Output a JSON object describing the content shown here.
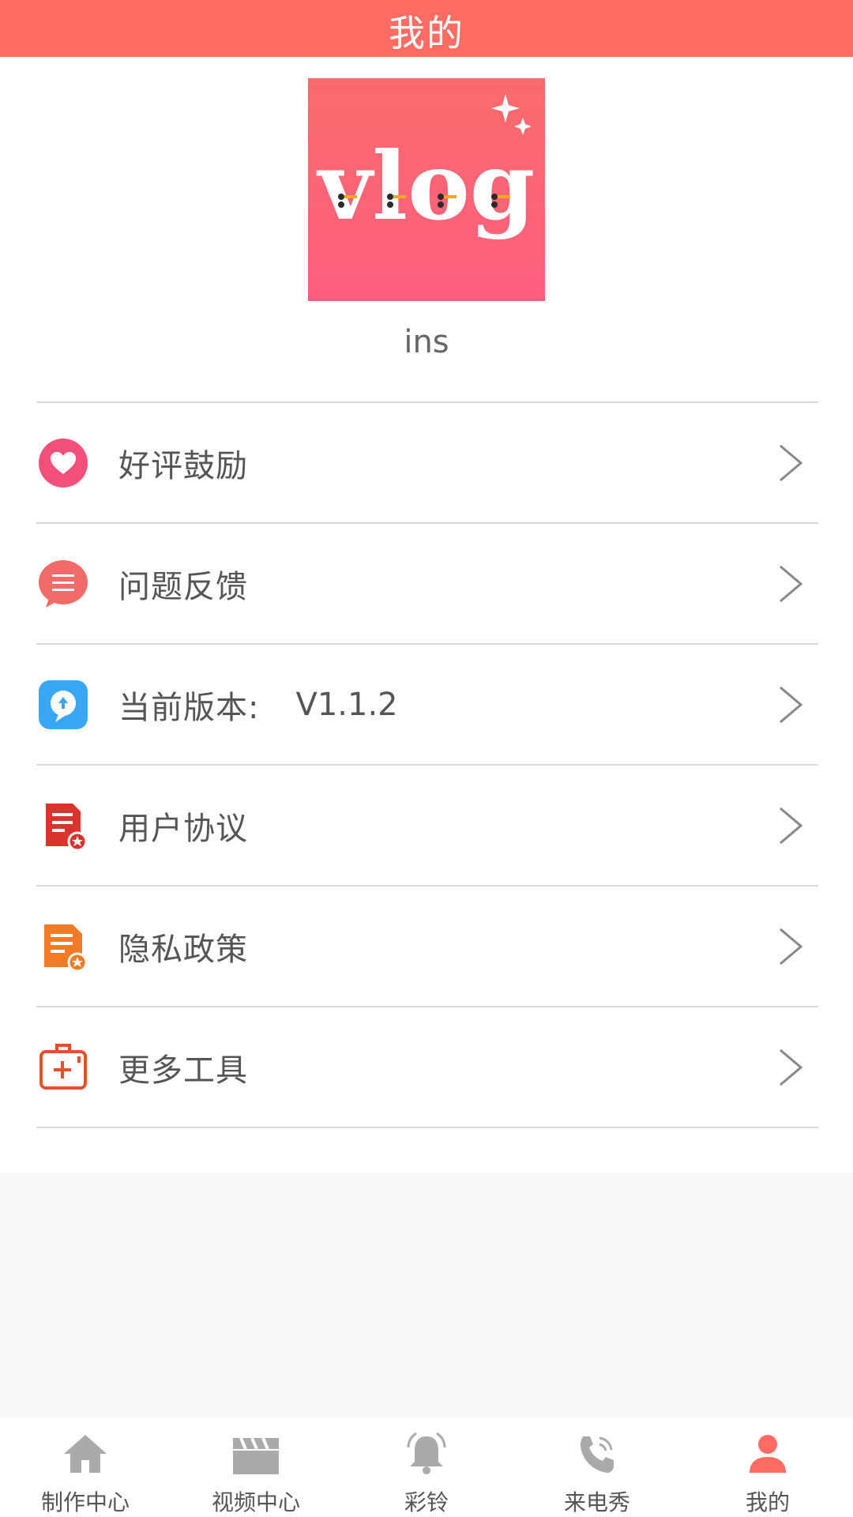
{
  "header": {
    "title": "我的"
  },
  "profile": {
    "logo_text": "vlog",
    "username": "ins"
  },
  "menu": [
    {
      "label": "好评鼓励",
      "value": "",
      "icon": "heart-icon",
      "color": "#F2507B"
    },
    {
      "label": "问题反馈",
      "value": "",
      "icon": "feedback-icon",
      "color": "#F26B6B"
    },
    {
      "label": "当前版本:",
      "value": "V1.1.2",
      "icon": "update-icon",
      "color": "#39A7F5"
    },
    {
      "label": "用户协议",
      "value": "",
      "icon": "agreement-icon",
      "color": "#D9342B"
    },
    {
      "label": "隐私政策",
      "value": "",
      "icon": "privacy-icon",
      "color": "#F07A25"
    },
    {
      "label": "更多工具",
      "value": "",
      "icon": "toolbox-icon",
      "color": "#E0532A"
    }
  ],
  "tabbar": [
    {
      "label": "制作中心",
      "icon": "home-icon",
      "active": false
    },
    {
      "label": "视频中心",
      "icon": "clapperboard-icon",
      "active": false
    },
    {
      "label": "彩铃",
      "icon": "bell-icon",
      "active": false
    },
    {
      "label": "来电秀",
      "icon": "phone-icon",
      "active": false
    },
    {
      "label": "我的",
      "icon": "person-icon",
      "active": true
    }
  ],
  "colors": {
    "accent": "#FD6C62",
    "tab_inactive": "#AAAAAA",
    "tab_active": "#FD6C62",
    "divider": "#D9D9D9"
  }
}
